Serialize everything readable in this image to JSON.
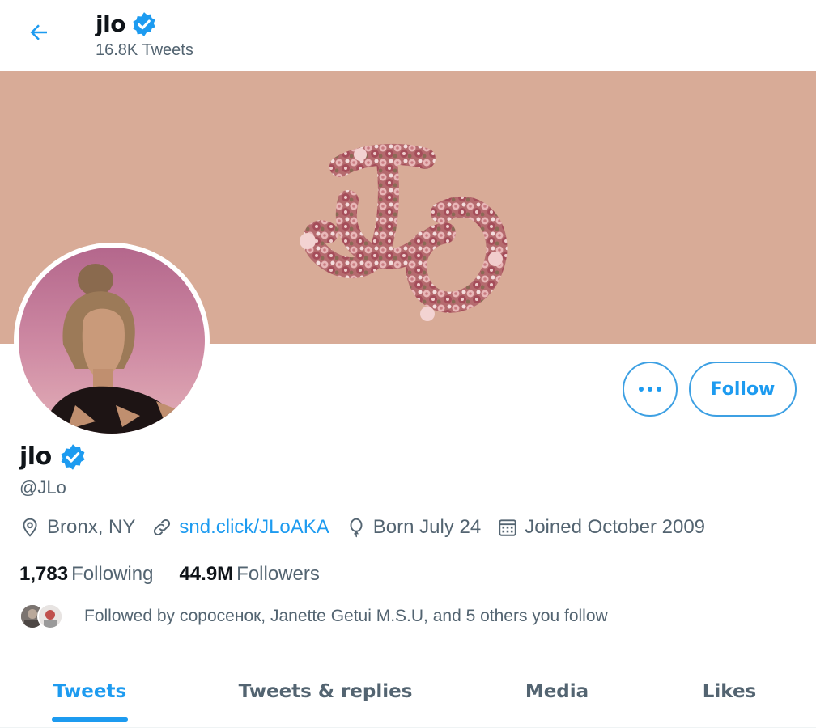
{
  "header": {
    "title": "jlo",
    "subtitle": "16.8K Tweets"
  },
  "banner": {
    "background_color": "#d8ab97",
    "logo_text": "JLo"
  },
  "actions": {
    "follow_label": "Follow",
    "more_icon": "more-dots-icon"
  },
  "profile": {
    "name": "jlo",
    "handle": "@JLo",
    "verified": true,
    "location": "Bronx, NY",
    "website": "snd.click/JLoAKA",
    "birthday": "Born July 24",
    "joined": "Joined October 2009"
  },
  "stats": {
    "following_count": "1,783",
    "following_label": "Following",
    "followers_count": "44.9M",
    "followers_label": "Followers"
  },
  "followed_by": {
    "text": "Followed by соросенок, Janette Getui M.S.U, and 5 others you follow"
  },
  "tabs": [
    {
      "label": "Tweets",
      "active": true
    },
    {
      "label": "Tweets & replies",
      "active": false
    },
    {
      "label": "Media",
      "active": false
    },
    {
      "label": "Likes",
      "active": false
    }
  ],
  "colors": {
    "accent": "#1d9bf0",
    "secondary_text": "#536471",
    "primary_text": "#0f1419"
  }
}
